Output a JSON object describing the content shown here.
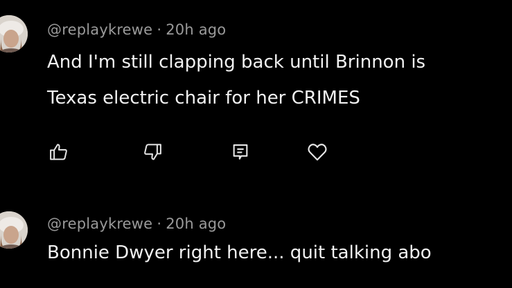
{
  "comments": [
    {
      "author": "@replaykrewe",
      "separator": "·",
      "timestamp": "20h ago",
      "text_lines": [
        "And I'm still clapping back until Brinnon is",
        "Texas electric chair for her CRIMES"
      ]
    },
    {
      "author": "@replaykrewe",
      "separator": "·",
      "timestamp": "20h ago",
      "text_lines": [
        "Bonnie Dwyer right here... quit talking abo"
      ]
    }
  ],
  "actions": {
    "like_icon": "thumbs-up-icon",
    "dislike_icon": "thumbs-down-icon",
    "reply_icon": "reply-icon",
    "heart_icon": "heart-icon"
  },
  "colors": {
    "background": "#000000",
    "text": "#f2f2f2",
    "meta": "#9a9a9a",
    "icon": "#e6e6e6"
  }
}
